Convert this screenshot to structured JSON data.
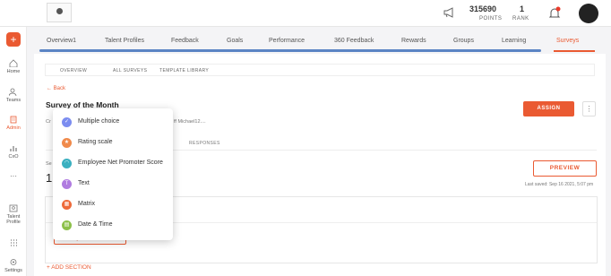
{
  "topbar": {
    "points_value": "315690",
    "points_label": "POINTS",
    "rank_value": "1",
    "rank_label": "RANK"
  },
  "sidebar": {
    "items": [
      {
        "label": "Home"
      },
      {
        "label": "Teams"
      },
      {
        "label": "Admin"
      },
      {
        "label": "CxO"
      },
      {
        "label": "···"
      },
      {
        "label": "Talent Profile"
      },
      {
        "label": "Settings"
      }
    ]
  },
  "tabs": [
    "Overview1",
    "Talent Profiles",
    "Feedback",
    "Goals",
    "Performance",
    "360 Feedback",
    "Rewards",
    "Groups",
    "Learning",
    "Surveys"
  ],
  "subtabs": [
    "OVERVIEW",
    "ALL SURVEYS",
    "TEMPLATE LIBRARY"
  ],
  "survey": {
    "back": "← Back",
    "title": "Survey of the Month",
    "creator_prefix": "Cr",
    "creator_suffix": "ff Michael12....",
    "assign": "ASSIGN",
    "more": "⋮",
    "responses": "RESPONSES",
    "section_prefix": "Se",
    "section_number": "1",
    "preview": "PREVIEW",
    "last_saved": "Last saved: Sep 16 2021, 5:07 pm",
    "add_question": "ADD QUESTION  +",
    "add_section": "+ ADD SECTION"
  },
  "dropdown": {
    "items": [
      {
        "label": "Multiple choice",
        "color": "#7c8df0",
        "icon": "check-icon"
      },
      {
        "label": "Rating scale",
        "color": "#f08a4b",
        "icon": "star-icon"
      },
      {
        "label": "Employee Net Promoter Score",
        "color": "#3bb0c0",
        "icon": "gauge-icon"
      },
      {
        "label": "Text",
        "color": "#b07ce0",
        "icon": "text-icon"
      },
      {
        "label": "Matrix",
        "color": "#ee6a3a",
        "icon": "grid-icon"
      },
      {
        "label": "Date & Time",
        "color": "#8cc04a",
        "icon": "calendar-icon"
      }
    ]
  },
  "colors": {
    "accent": "#ea5a32",
    "tab_line": "#5b84c4"
  }
}
